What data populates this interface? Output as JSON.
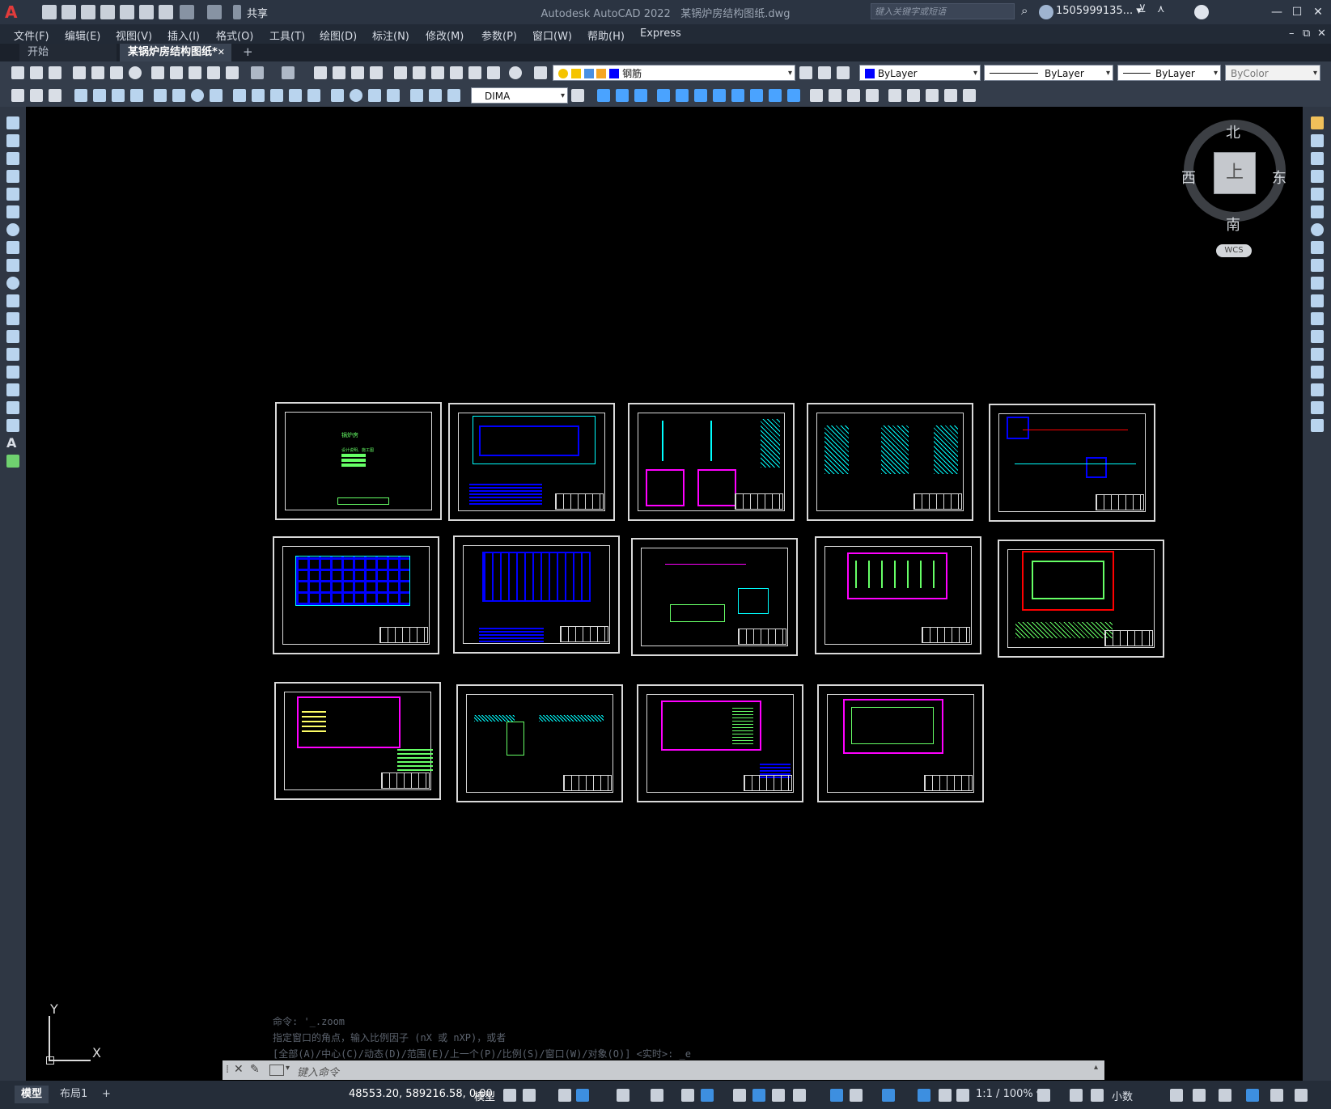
{
  "titlebar": {
    "app": "Autodesk AutoCAD 2022",
    "file": "某锅炉房结构图纸.dwg",
    "share_label": "共享",
    "search_placeholder": "键入关键字或短语",
    "user": "1505999135... ▾"
  },
  "menu": [
    "文件(F)",
    "编辑(E)",
    "视图(V)",
    "插入(I)",
    "格式(O)",
    "工具(T)",
    "绘图(D)",
    "标注(N)",
    "修改(M)",
    "参数(P)",
    "窗口(W)",
    "帮助(H)",
    "Express"
  ],
  "tabs": {
    "start": "开始",
    "active": "某锅炉房结构图纸*",
    "close": "✕",
    "plus": "+"
  },
  "toolbar": {
    "layer": "钢筋",
    "color": "ByLayer",
    "linetype": "ByLayer",
    "lineweight": "ByLayer",
    "plotstyle": "ByColor",
    "dimstyle": "DIMA"
  },
  "viewcube": {
    "north": "北",
    "south": "南",
    "east": "东",
    "west": "西",
    "top": "上",
    "wcs": "WCS"
  },
  "command": {
    "history": [
      "命令: '_.zoom",
      "指定窗口的角点，输入比例因子 (nX 或 nXP)，或者",
      "[全部(A)/中心(C)/动态(D)/范围(E)/上一个(P)/比例(S)/窗口(W)/对象(O)] <实时>: _e"
    ],
    "placeholder": "键入命令"
  },
  "ucs": {
    "x": "X",
    "y": "Y"
  },
  "status": {
    "model_tab": "模型",
    "layout_tab": "布局1",
    "add": "+",
    "coords": "48553.20, 589216.58, 0.00",
    "space": "模型",
    "scale": "1:1 / 100% ▾",
    "units": "小数"
  },
  "sheets": {
    "cover_title": "锅炉房",
    "cover_sub": "设计说明、施工图"
  },
  "colors": {
    "canvas": "#000000",
    "cyan": "#00ffff",
    "blue": "#0000ff",
    "red": "#ff0000",
    "magenta": "#ff00ff",
    "green": "#66ff66",
    "yellow": "#ffff66"
  }
}
